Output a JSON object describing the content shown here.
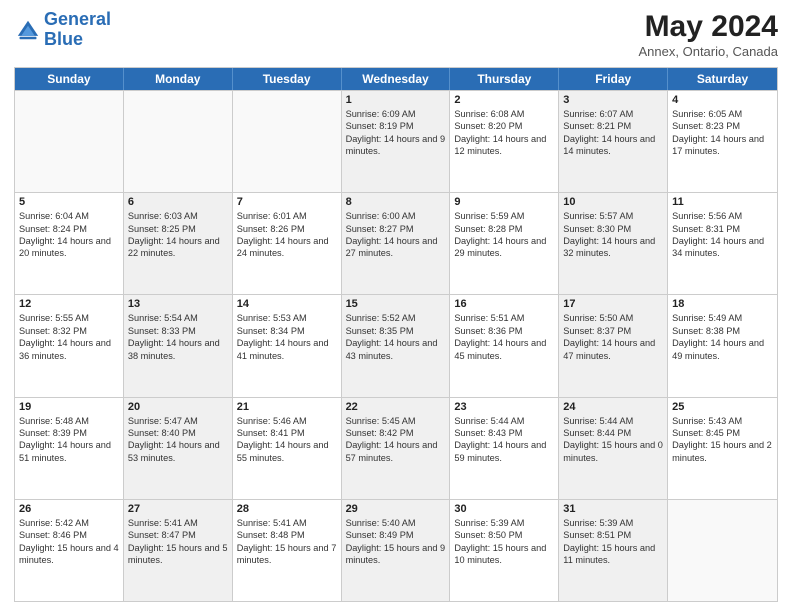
{
  "header": {
    "logo_line1": "General",
    "logo_line2": "Blue",
    "month": "May 2024",
    "location": "Annex, Ontario, Canada"
  },
  "days_of_week": [
    "Sunday",
    "Monday",
    "Tuesday",
    "Wednesday",
    "Thursday",
    "Friday",
    "Saturday"
  ],
  "weeks": [
    [
      {
        "day": "",
        "sunrise": "",
        "sunset": "",
        "daylight": "",
        "shaded": false,
        "empty": true
      },
      {
        "day": "",
        "sunrise": "",
        "sunset": "",
        "daylight": "",
        "shaded": false,
        "empty": true
      },
      {
        "day": "",
        "sunrise": "",
        "sunset": "",
        "daylight": "",
        "shaded": false,
        "empty": true
      },
      {
        "day": "1",
        "sunrise": "Sunrise: 6:09 AM",
        "sunset": "Sunset: 8:19 PM",
        "daylight": "Daylight: 14 hours and 9 minutes.",
        "shaded": true,
        "empty": false
      },
      {
        "day": "2",
        "sunrise": "Sunrise: 6:08 AM",
        "sunset": "Sunset: 8:20 PM",
        "daylight": "Daylight: 14 hours and 12 minutes.",
        "shaded": false,
        "empty": false
      },
      {
        "day": "3",
        "sunrise": "Sunrise: 6:07 AM",
        "sunset": "Sunset: 8:21 PM",
        "daylight": "Daylight: 14 hours and 14 minutes.",
        "shaded": true,
        "empty": false
      },
      {
        "day": "4",
        "sunrise": "Sunrise: 6:05 AM",
        "sunset": "Sunset: 8:23 PM",
        "daylight": "Daylight: 14 hours and 17 minutes.",
        "shaded": false,
        "empty": false
      }
    ],
    [
      {
        "day": "5",
        "sunrise": "Sunrise: 6:04 AM",
        "sunset": "Sunset: 8:24 PM",
        "daylight": "Daylight: 14 hours and 20 minutes.",
        "shaded": false,
        "empty": false
      },
      {
        "day": "6",
        "sunrise": "Sunrise: 6:03 AM",
        "sunset": "Sunset: 8:25 PM",
        "daylight": "Daylight: 14 hours and 22 minutes.",
        "shaded": true,
        "empty": false
      },
      {
        "day": "7",
        "sunrise": "Sunrise: 6:01 AM",
        "sunset": "Sunset: 8:26 PM",
        "daylight": "Daylight: 14 hours and 24 minutes.",
        "shaded": false,
        "empty": false
      },
      {
        "day": "8",
        "sunrise": "Sunrise: 6:00 AM",
        "sunset": "Sunset: 8:27 PM",
        "daylight": "Daylight: 14 hours and 27 minutes.",
        "shaded": true,
        "empty": false
      },
      {
        "day": "9",
        "sunrise": "Sunrise: 5:59 AM",
        "sunset": "Sunset: 8:28 PM",
        "daylight": "Daylight: 14 hours and 29 minutes.",
        "shaded": false,
        "empty": false
      },
      {
        "day": "10",
        "sunrise": "Sunrise: 5:57 AM",
        "sunset": "Sunset: 8:30 PM",
        "daylight": "Daylight: 14 hours and 32 minutes.",
        "shaded": true,
        "empty": false
      },
      {
        "day": "11",
        "sunrise": "Sunrise: 5:56 AM",
        "sunset": "Sunset: 8:31 PM",
        "daylight": "Daylight: 14 hours and 34 minutes.",
        "shaded": false,
        "empty": false
      }
    ],
    [
      {
        "day": "12",
        "sunrise": "Sunrise: 5:55 AM",
        "sunset": "Sunset: 8:32 PM",
        "daylight": "Daylight: 14 hours and 36 minutes.",
        "shaded": false,
        "empty": false
      },
      {
        "day": "13",
        "sunrise": "Sunrise: 5:54 AM",
        "sunset": "Sunset: 8:33 PM",
        "daylight": "Daylight: 14 hours and 38 minutes.",
        "shaded": true,
        "empty": false
      },
      {
        "day": "14",
        "sunrise": "Sunrise: 5:53 AM",
        "sunset": "Sunset: 8:34 PM",
        "daylight": "Daylight: 14 hours and 41 minutes.",
        "shaded": false,
        "empty": false
      },
      {
        "day": "15",
        "sunrise": "Sunrise: 5:52 AM",
        "sunset": "Sunset: 8:35 PM",
        "daylight": "Daylight: 14 hours and 43 minutes.",
        "shaded": true,
        "empty": false
      },
      {
        "day": "16",
        "sunrise": "Sunrise: 5:51 AM",
        "sunset": "Sunset: 8:36 PM",
        "daylight": "Daylight: 14 hours and 45 minutes.",
        "shaded": false,
        "empty": false
      },
      {
        "day": "17",
        "sunrise": "Sunrise: 5:50 AM",
        "sunset": "Sunset: 8:37 PM",
        "daylight": "Daylight: 14 hours and 47 minutes.",
        "shaded": true,
        "empty": false
      },
      {
        "day": "18",
        "sunrise": "Sunrise: 5:49 AM",
        "sunset": "Sunset: 8:38 PM",
        "daylight": "Daylight: 14 hours and 49 minutes.",
        "shaded": false,
        "empty": false
      }
    ],
    [
      {
        "day": "19",
        "sunrise": "Sunrise: 5:48 AM",
        "sunset": "Sunset: 8:39 PM",
        "daylight": "Daylight: 14 hours and 51 minutes.",
        "shaded": false,
        "empty": false
      },
      {
        "day": "20",
        "sunrise": "Sunrise: 5:47 AM",
        "sunset": "Sunset: 8:40 PM",
        "daylight": "Daylight: 14 hours and 53 minutes.",
        "shaded": true,
        "empty": false
      },
      {
        "day": "21",
        "sunrise": "Sunrise: 5:46 AM",
        "sunset": "Sunset: 8:41 PM",
        "daylight": "Daylight: 14 hours and 55 minutes.",
        "shaded": false,
        "empty": false
      },
      {
        "day": "22",
        "sunrise": "Sunrise: 5:45 AM",
        "sunset": "Sunset: 8:42 PM",
        "daylight": "Daylight: 14 hours and 57 minutes.",
        "shaded": true,
        "empty": false
      },
      {
        "day": "23",
        "sunrise": "Sunrise: 5:44 AM",
        "sunset": "Sunset: 8:43 PM",
        "daylight": "Daylight: 14 hours and 59 minutes.",
        "shaded": false,
        "empty": false
      },
      {
        "day": "24",
        "sunrise": "Sunrise: 5:44 AM",
        "sunset": "Sunset: 8:44 PM",
        "daylight": "Daylight: 15 hours and 0 minutes.",
        "shaded": true,
        "empty": false
      },
      {
        "day": "25",
        "sunrise": "Sunrise: 5:43 AM",
        "sunset": "Sunset: 8:45 PM",
        "daylight": "Daylight: 15 hours and 2 minutes.",
        "shaded": false,
        "empty": false
      }
    ],
    [
      {
        "day": "26",
        "sunrise": "Sunrise: 5:42 AM",
        "sunset": "Sunset: 8:46 PM",
        "daylight": "Daylight: 15 hours and 4 minutes.",
        "shaded": false,
        "empty": false
      },
      {
        "day": "27",
        "sunrise": "Sunrise: 5:41 AM",
        "sunset": "Sunset: 8:47 PM",
        "daylight": "Daylight: 15 hours and 5 minutes.",
        "shaded": true,
        "empty": false
      },
      {
        "day": "28",
        "sunrise": "Sunrise: 5:41 AM",
        "sunset": "Sunset: 8:48 PM",
        "daylight": "Daylight: 15 hours and 7 minutes.",
        "shaded": false,
        "empty": false
      },
      {
        "day": "29",
        "sunrise": "Sunrise: 5:40 AM",
        "sunset": "Sunset: 8:49 PM",
        "daylight": "Daylight: 15 hours and 9 minutes.",
        "shaded": true,
        "empty": false
      },
      {
        "day": "30",
        "sunrise": "Sunrise: 5:39 AM",
        "sunset": "Sunset: 8:50 PM",
        "daylight": "Daylight: 15 hours and 10 minutes.",
        "shaded": false,
        "empty": false
      },
      {
        "day": "31",
        "sunrise": "Sunrise: 5:39 AM",
        "sunset": "Sunset: 8:51 PM",
        "daylight": "Daylight: 15 hours and 11 minutes.",
        "shaded": true,
        "empty": false
      },
      {
        "day": "",
        "sunrise": "",
        "sunset": "",
        "daylight": "",
        "shaded": false,
        "empty": true
      }
    ]
  ]
}
